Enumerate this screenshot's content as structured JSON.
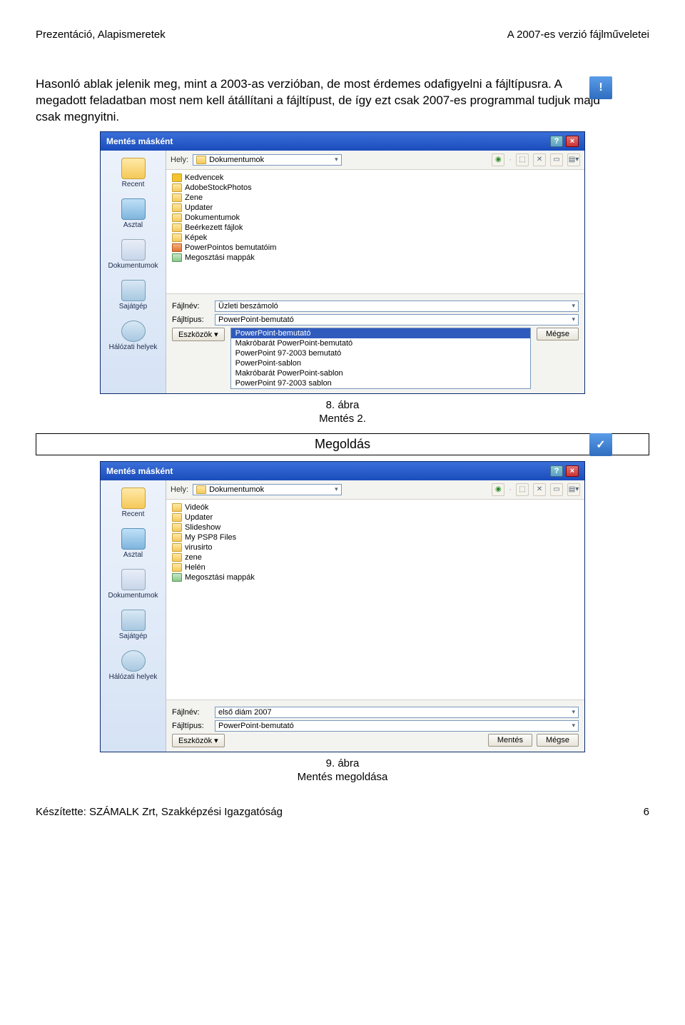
{
  "header": {
    "left": "Prezentáció, Alapismeretek",
    "right": "A 2007-es verzió fájlműveletei"
  },
  "paragraph": "Hasonló ablak jelenik meg, mint a 2003-as verzióban, de most érdemes odafigyelni a fájltípusra. A megadott feladatban most nem kell átállítani a fájltípust, de így ezt csak 2007-es programmal tudjuk majd csak megnyitni.",
  "dialog1": {
    "title": "Mentés másként",
    "location_label": "Hely:",
    "location_value": "Dokumentumok",
    "places": [
      "Recent",
      "Asztal",
      "Dokumentumok",
      "Sajátgép",
      "Hálózati helyek"
    ],
    "files": [
      {
        "t": "fav",
        "n": "Kedvencek"
      },
      {
        "t": "fold",
        "n": "AdobeStockPhotos"
      },
      {
        "t": "fold",
        "n": "Zene"
      },
      {
        "t": "fold",
        "n": "Updater"
      },
      {
        "t": "fold",
        "n": "Dokumentumok"
      },
      {
        "t": "fold",
        "n": "Beérkezett fájlok"
      },
      {
        "t": "fold",
        "n": "Képek"
      },
      {
        "t": "ppt",
        "n": "PowerPointos bemutatóim"
      },
      {
        "t": "share",
        "n": "Megosztási mappák"
      }
    ],
    "filename_label": "Fájlnév:",
    "filename_value": "Üzleti beszámoló",
    "filetype_label": "Fájltípus:",
    "filetype_value": "PowerPoint-bemutató",
    "tools_btn": "Eszközök",
    "cancel_btn": "Mégse",
    "dropdown": [
      "PowerPoint-bemutató",
      "Makróbarát PowerPoint-bemutató",
      "PowerPoint 97-2003 bemutató",
      "PowerPoint-sablon",
      "Makróbarát PowerPoint-sablon",
      "PowerPoint 97-2003 sablon"
    ]
  },
  "caption1": {
    "line1": "8. ábra",
    "line2": "Mentés 2."
  },
  "megoldas": "Megoldás",
  "dialog2": {
    "title": "Mentés másként",
    "location_label": "Hely:",
    "location_value": "Dokumentumok",
    "places": [
      "Recent",
      "Asztal",
      "Dokumentumok",
      "Sajátgép",
      "Hálózati helyek"
    ],
    "files": [
      {
        "t": "fold",
        "n": "Videók"
      },
      {
        "t": "fold",
        "n": "Updater"
      },
      {
        "t": "fold",
        "n": "Slideshow"
      },
      {
        "t": "fold",
        "n": "My PSP8 Files"
      },
      {
        "t": "fold",
        "n": "virusirto"
      },
      {
        "t": "fold",
        "n": "zene"
      },
      {
        "t": "fold",
        "n": "Helén"
      },
      {
        "t": "share",
        "n": "Megosztási mappák"
      }
    ],
    "filename_label": "Fájlnév:",
    "filename_value": "első diám 2007",
    "filetype_label": "Fájltípus:",
    "filetype_value": "PowerPoint-bemutató",
    "tools_btn": "Eszközök",
    "save_btn": "Mentés",
    "cancel_btn": "Mégse"
  },
  "caption2": {
    "line1": "9. ábra",
    "line2": "Mentés megoldása"
  },
  "footer": {
    "left": "Készítette: SZÁMALK Zrt, Szakképzési Igazgatóság",
    "right": "6"
  }
}
